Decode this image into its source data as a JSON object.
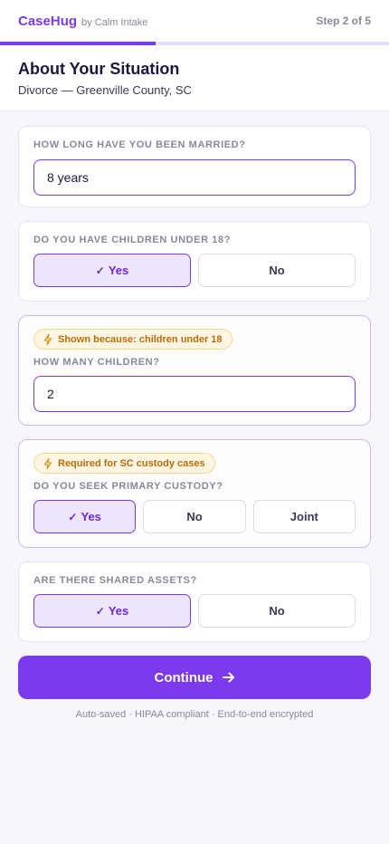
{
  "header": {
    "brand_name": "CaseHug",
    "brand_by": "by Calm Intake",
    "step_text": "Step 2 of 5",
    "progress_fraction": 0.4
  },
  "page": {
    "title": "About Your Situation",
    "subtitle": "Divorce — Greenville County, SC"
  },
  "questions": {
    "married": {
      "label": "HOW LONG HAVE YOU BEEN MARRIED?",
      "value": "8 years"
    },
    "children": {
      "label": "DO YOU HAVE CHILDREN UNDER 18?",
      "options": [
        "Yes",
        "No"
      ],
      "selected": "Yes"
    },
    "num_children": {
      "badge": "Shown because: children under 18",
      "label": "HOW MANY CHILDREN?",
      "value": "2"
    },
    "custody": {
      "badge": "Required for SC custody cases",
      "label": "DO YOU SEEK PRIMARY CUSTODY?",
      "options": [
        "Yes",
        "No",
        "Joint"
      ],
      "selected": "Yes"
    },
    "assets": {
      "label": "ARE THERE SHARED ASSETS?",
      "options": [
        "Yes",
        "No"
      ],
      "selected": "Yes"
    }
  },
  "actions": {
    "continue_label": "Continue"
  },
  "footer": {
    "note": "Auto-saved · HIPAA compliant · End-to-end encrypted"
  },
  "icons": {
    "check": "checkmark-icon",
    "bolt": "lightning-bolt-icon",
    "arrow": "arrow-right-icon"
  },
  "colors": {
    "accent": "#7c3aed",
    "selected_bg": "#ede5fd",
    "badge_bg": "#fef6e2",
    "badge_text": "#b86d0a"
  }
}
